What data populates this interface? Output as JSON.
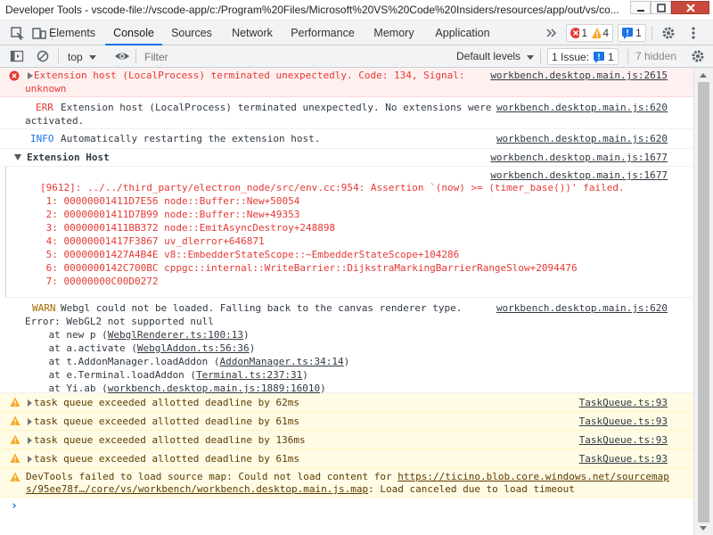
{
  "window": {
    "title": "Developer Tools - vscode-file://vscode-app/c:/Program%20Files/Microsoft%20VS%20Code%20Insiders/resources/app/out/vs/co..."
  },
  "tabs": [
    {
      "label": "Elements"
    },
    {
      "label": "Console"
    },
    {
      "label": "Sources"
    },
    {
      "label": "Network"
    },
    {
      "label": "Performance"
    },
    {
      "label": "Memory"
    },
    {
      "label": "Application"
    }
  ],
  "badges": {
    "errors": "1",
    "warnings": "4",
    "issues": "1"
  },
  "toolbar": {
    "context": "top",
    "filter_placeholder": "Filter",
    "levels": "Default levels",
    "issues_label": "1 Issue:",
    "issues_count": "1",
    "hidden": "7 hidden"
  },
  "console": {
    "m1": {
      "line1": "Extension host (LocalProcess) terminated unexpectedly. Code: 134, Signal:",
      "line2": "unknown",
      "src": "workbench.desktop.main.js:2615"
    },
    "m2": {
      "level": "ERR",
      "line1": "Extension host (LocalProcess) terminated unexpectedly. No extensions were",
      "line2": "activated.",
      "src": "workbench.desktop.main.js:620"
    },
    "m3": {
      "level": "INFO",
      "line1": "Automatically restarting the extension host.",
      "src": "workbench.desktop.main.js:620"
    },
    "m4": {
      "group": "Extension Host",
      "src": "workbench.desktop.main.js:1677"
    },
    "m5": {
      "src": "workbench.desktop.main.js:1677",
      "lines": [
        "[9612]: ../../third_party/electron_node/src/env.cc:954: Assertion `(now) >= (timer_base())' failed.",
        " 1: 00000001411D7E56 node::Buffer::New+50054",
        " 2: 00000001411D7B99 node::Buffer::New+49353",
        " 3: 00000001411BB372 node::EmitAsyncDestroy+248898",
        " 4: 00000001417F3867 uv_dlerror+646871",
        " 5: 00000001427A4B4E v8::EmbedderStateScope::~EmbedderStateScope+104286",
        " 6: 0000000142C700BC cppgc::internal::WriteBarrier::DijkstraMarkingBarrierRangeSlow+2094476",
        " 7: 00000000C00D0272"
      ]
    },
    "m6": {
      "level": "WARN",
      "line1": "Webgl could not be loaded. Falling back to the canvas renderer type.",
      "src": "workbench.desktop.main.js:620",
      "error": "Error: WebGL2 not supported null",
      "stack": [
        {
          "prefix": "    at new p (",
          "link": "WebglRenderer.ts:100:13",
          "suffix": ")"
        },
        {
          "prefix": "    at a.activate (",
          "link": "WebglAddon.ts:56:36",
          "suffix": ")"
        },
        {
          "prefix": "    at t.AddonManager.loadAddon (",
          "link": "AddonManager.ts:34:14",
          "suffix": ")"
        },
        {
          "prefix": "    at e.Terminal.loadAddon (",
          "link": "Terminal.ts:237:31",
          "suffix": ")"
        },
        {
          "prefix": "    at Yi.ab (",
          "link": "workbench.desktop.main.js:1889:16010",
          "suffix": ")"
        }
      ]
    },
    "w1": {
      "text": "task queue exceeded allotted deadline by 62ms",
      "src": "TaskQueue.ts:93"
    },
    "w2": {
      "text": "task queue exceeded allotted deadline by 61ms",
      "src": "TaskQueue.ts:93"
    },
    "w3": {
      "text": "task queue exceeded allotted deadline by 136ms",
      "src": "TaskQueue.ts:93"
    },
    "w4": {
      "text": "task queue exceeded allotted deadline by 61ms",
      "src": "TaskQueue.ts:93"
    },
    "w5": {
      "prefix": "DevTools failed to load source map: Could not load content for ",
      "link1": "https://ticino.blob.core.windows.net/sourcemap",
      "link2": "s/95ee78f…/core/vs/workbench/workbench.desktop.main.js.map",
      "suffix": ": Load canceled due to load timeout"
    },
    "prompt": "›"
  },
  "colors": {
    "error": "#e53935",
    "warning": "#f9a825",
    "accent": "#1a73e8"
  }
}
